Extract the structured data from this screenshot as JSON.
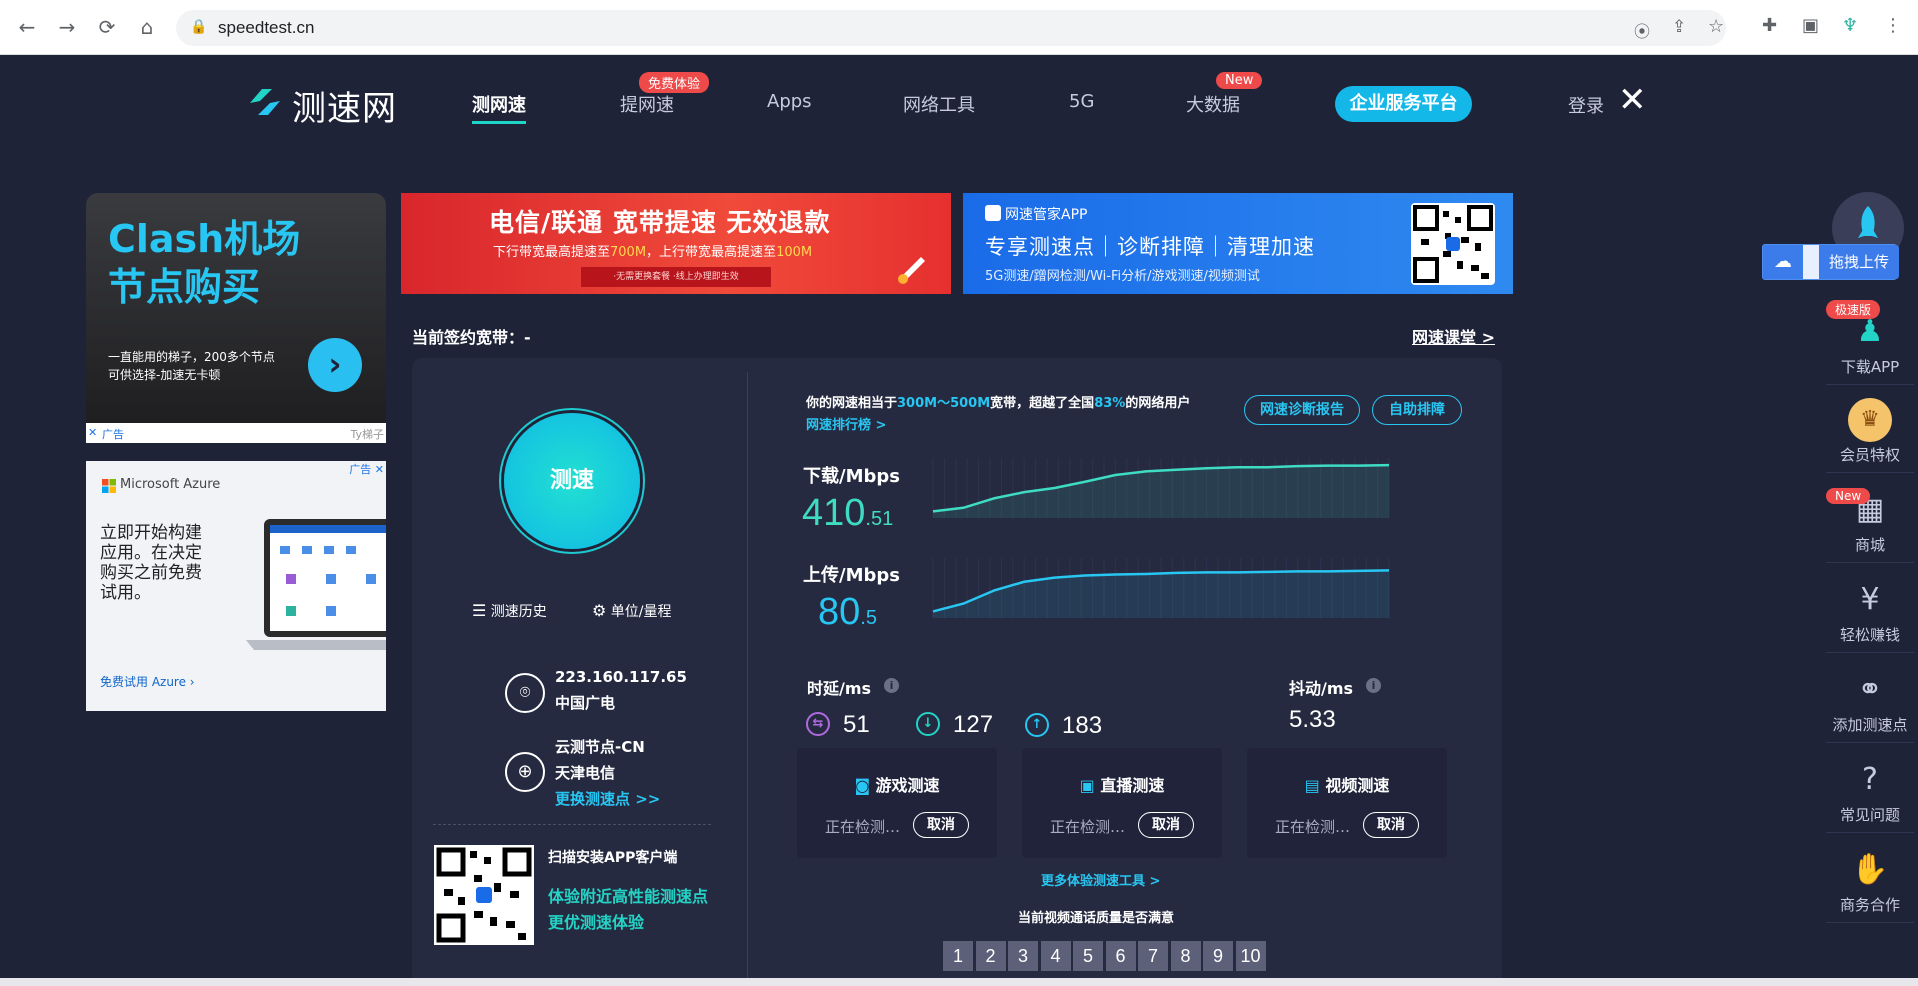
{
  "browser": {
    "url": "speedtest.cn"
  },
  "nav": {
    "logo_text": "测速网",
    "items": [
      {
        "label": "测网速",
        "active": true
      },
      {
        "label": "提网速",
        "badge": "免费体验"
      },
      {
        "label": "Apps"
      },
      {
        "label": "网络工具"
      },
      {
        "label": "5G"
      },
      {
        "label": "大数据",
        "badge": "New"
      }
    ],
    "enterprise": "企业服务平台",
    "login": "登录"
  },
  "ads": {
    "clash_title_line1": "Clash机场",
    "clash_title_line2": "节点购买",
    "clash_sub_line1": "一直能用的梯子，200多个节点",
    "clash_sub_line2": "可供选择-加速无卡顿",
    "ad_label": "广告",
    "clash_source": "Ty梯子",
    "azure_brand": "Microsoft Azure",
    "azure_text": "立即开始构建应用。在决定购买之前免费试用。",
    "azure_cta": "免费试用 Azure ›"
  },
  "banners": {
    "telecom_title": "电信/联通 宽带提速 无效退款",
    "telecom_sub_prefix": "下行带宽最高提速至",
    "telecom_sub_down": "700M",
    "telecom_sub_mid": "，上行带宽最高提速至",
    "telecom_sub_up": "100M",
    "telecom_pill": "·无需更换套餐 ·线上办理即生效",
    "app_name": "网速管家APP",
    "app_title": "专享测速点｜诊断排障｜清理加速",
    "app_sub": "5G测速/蹭网检测/Wi-Fi分析/游戏测速/视频测试"
  },
  "contract": "当前签约宽带：-",
  "course": "网速课堂 >",
  "left_panel": {
    "go": "测速",
    "history": "测速历史",
    "unit": "单位/量程",
    "ip": "223.160.117.65",
    "isp": "中国广电",
    "node": "云测节点-CN",
    "node_isp": "天津电信",
    "change_node": "更换测速点 >>",
    "scan_label": "扫描安装APP客户端",
    "scan_line1": "体验附近高性能测速点",
    "scan_line2": "更优测速体验"
  },
  "results": {
    "summary_prefix": "你的网速相当于",
    "summary_range": "300M～500M",
    "summary_mid": "宽带，超越了全国",
    "summary_pct": "83%",
    "summary_suffix": "的网络用户",
    "rank_link": "网速排行榜 >",
    "diag_btn": "网速诊断报告",
    "fix_btn": "自助排障",
    "download_label": "下载/Mbps",
    "download_int": "410",
    "download_dec": ".51",
    "upload_label": "上传/Mbps",
    "upload_int": "80",
    "upload_dec": ".5",
    "latency_label": "时延/ms",
    "jitter_label": "抖动/ms",
    "latency_idle": "51",
    "latency_down": "127",
    "latency_up": "183",
    "jitter": "5.33",
    "cards": [
      {
        "title": "游戏测速",
        "status": "正在检测…",
        "cancel": "取消"
      },
      {
        "title": "直播测速",
        "status": "正在检测…",
        "cancel": "取消"
      },
      {
        "title": "视频测速",
        "status": "正在检测…",
        "cancel": "取消"
      }
    ],
    "more_tools": "更多体验测速工具 >",
    "satisfaction": "当前视频通话质量是否满意",
    "ratings": [
      "1",
      "2",
      "3",
      "4",
      "5",
      "6",
      "7",
      "8",
      "9",
      "10"
    ],
    "download_curve": [
      0.05,
      0.12,
      0.3,
      0.42,
      0.5,
      0.62,
      0.75,
      0.82,
      0.85,
      0.88,
      0.9,
      0.9,
      0.92,
      0.93,
      0.93,
      0.94
    ],
    "upload_curve": [
      0.05,
      0.2,
      0.45,
      0.62,
      0.7,
      0.74,
      0.76,
      0.77,
      0.79,
      0.8,
      0.8,
      0.81,
      0.82,
      0.82,
      0.83,
      0.84
    ]
  },
  "sidebar": {
    "drag_upload": "拖拽上传",
    "items": [
      {
        "label": "下载APP",
        "badge": "极速版",
        "icon": "android-icon"
      },
      {
        "label": "会员特权",
        "icon": "crown-icon"
      },
      {
        "label": "商城",
        "badge": "New",
        "icon": "store-icon"
      },
      {
        "label": "轻松赚钱",
        "icon": "money-bag-icon"
      },
      {
        "label": "添加测速点",
        "icon": "network-icon"
      },
      {
        "label": "常见问题",
        "icon": "question-icon"
      },
      {
        "label": "商务合作",
        "icon": "handshake-icon"
      }
    ]
  },
  "colors": {
    "bg": "#1f2338",
    "panel": "#262a40",
    "accent_teal": "#23d3c5",
    "accent_blue": "#28c6f2",
    "download_value": "#3fdcc4",
    "upload_value": "#28c6f2"
  }
}
